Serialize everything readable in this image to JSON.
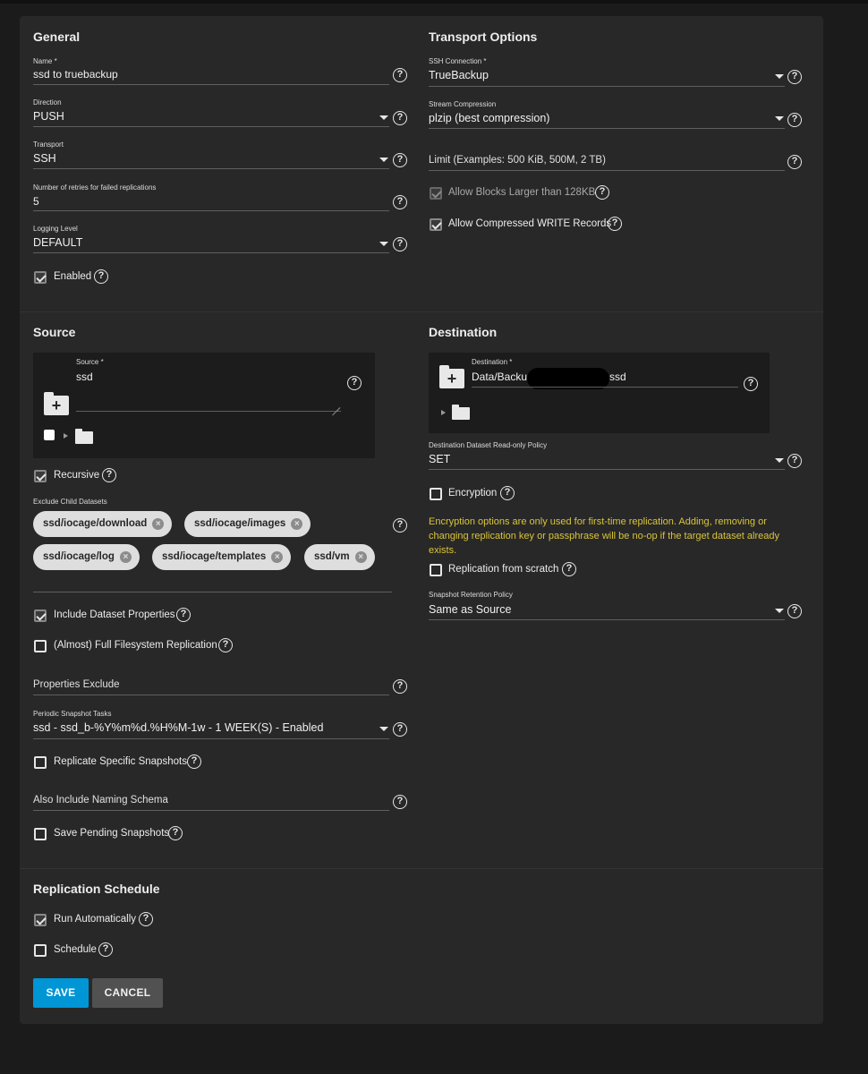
{
  "general": {
    "title": "General",
    "name": {
      "label": "Name *",
      "value": "ssd to truebackup"
    },
    "direction": {
      "label": "Direction",
      "value": "PUSH"
    },
    "transport": {
      "label": "Transport",
      "value": "SSH"
    },
    "retries": {
      "label": "Number of retries for failed replications",
      "value": "5"
    },
    "logging": {
      "label": "Logging Level",
      "value": "DEFAULT"
    },
    "enabled": {
      "label": "Enabled",
      "checked": true
    }
  },
  "transport_options": {
    "title": "Transport Options",
    "ssh_connection": {
      "label": "SSH Connection *",
      "value": "TrueBackup"
    },
    "stream_compression": {
      "label": "Stream Compression",
      "value": "plzip (best compression)"
    },
    "limit": {
      "placeholder": "Limit (Examples: 500 KiB, 500M, 2 TB)"
    },
    "allow_blocks": {
      "label": "Allow Blocks Larger than 128KB",
      "checked": true,
      "disabled": true
    },
    "allow_compressed": {
      "label": "Allow Compressed WRITE Records",
      "checked": true
    }
  },
  "source": {
    "title": "Source",
    "source_field": {
      "label": "Source *",
      "value": "ssd"
    },
    "recursive": {
      "label": "Recursive",
      "checked": true
    },
    "exclude_label": "Exclude Child Datasets",
    "exclude_chips": [
      "ssd/iocage/download",
      "ssd/iocage/images",
      "ssd/iocage/log",
      "ssd/iocage/templates",
      "ssd/vm"
    ],
    "include_props": {
      "label": "Include Dataset Properties",
      "checked": true
    },
    "full_fs": {
      "label": "(Almost) Full Filesystem Replication",
      "checked": false
    },
    "properties_exclude": {
      "placeholder": "Properties Exclude"
    },
    "periodic_tasks": {
      "label": "Periodic Snapshot Tasks",
      "value": "ssd - ssd_b-%Y%m%d.%H%M-1w - 1 WEEK(S) - Enabled"
    },
    "replicate_specific": {
      "label": "Replicate Specific Snapshots",
      "checked": false
    },
    "naming_schema": {
      "placeholder": "Also Include Naming Schema"
    },
    "save_pending": {
      "label": "Save Pending Snapshots",
      "checked": false
    }
  },
  "destination": {
    "title": "Destination",
    "destination_field": {
      "label": "Destination *",
      "value_prefix": "Data/Backu",
      "value_suffix": "ssd"
    },
    "readonly_policy": {
      "label": "Destination Dataset Read-only Policy",
      "value": "SET"
    },
    "encryption": {
      "label": "Encryption",
      "checked": false
    },
    "encryption_note": "Encryption options are only used for first-time replication. Adding, removing or changing replication key or passphrase will be no-op if the target dataset already exists.",
    "from_scratch": {
      "label": "Replication from scratch",
      "checked": false
    },
    "retention": {
      "label": "Snapshot Retention Policy",
      "value": "Same as Source"
    }
  },
  "schedule": {
    "title": "Replication Schedule",
    "run_auto": {
      "label": "Run Automatically",
      "checked": true
    },
    "schedule": {
      "label": "Schedule",
      "checked": false
    }
  },
  "actions": {
    "save": "SAVE",
    "cancel": "CANCEL"
  },
  "colors": {
    "accent": "#0095d5",
    "warning": "#d9c43a",
    "card": "#282828",
    "background": "#1b1b1b"
  }
}
